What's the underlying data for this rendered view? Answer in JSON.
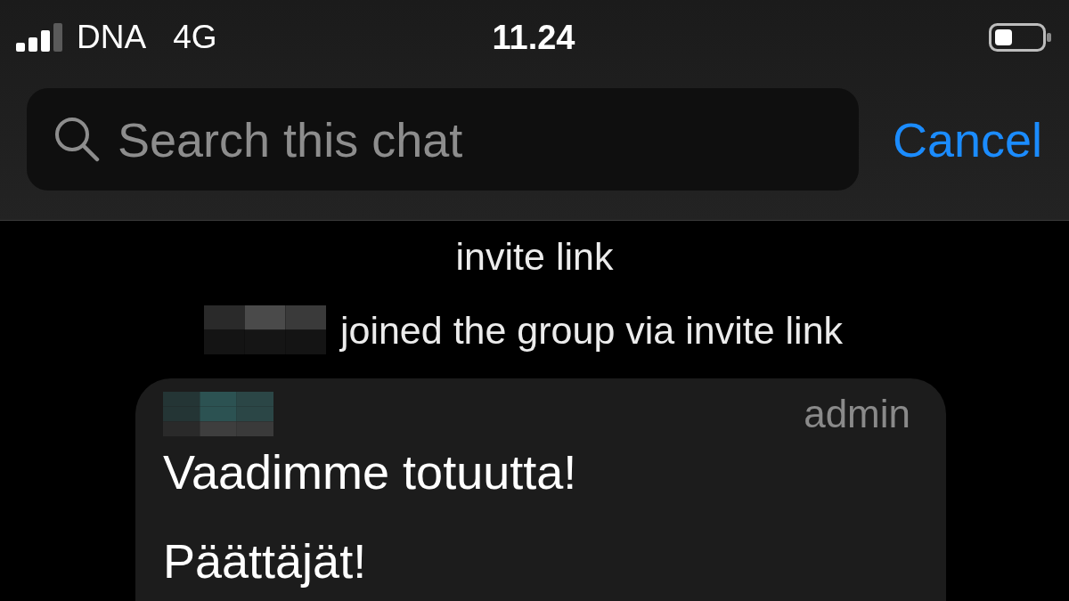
{
  "status_bar": {
    "carrier": "DNA",
    "network": "4G",
    "time": "11.24"
  },
  "search": {
    "placeholder": "Search this chat",
    "cancel": "Cancel"
  },
  "events": [
    {
      "text": "invite link",
      "redacted_name": false
    },
    {
      "text": "joined the group via invite link",
      "redacted_name": true
    }
  ],
  "message": {
    "redacted_author": true,
    "role": "admin",
    "paragraphs": [
      "Vaadimme totuutta!",
      "Päättäjät!"
    ]
  }
}
